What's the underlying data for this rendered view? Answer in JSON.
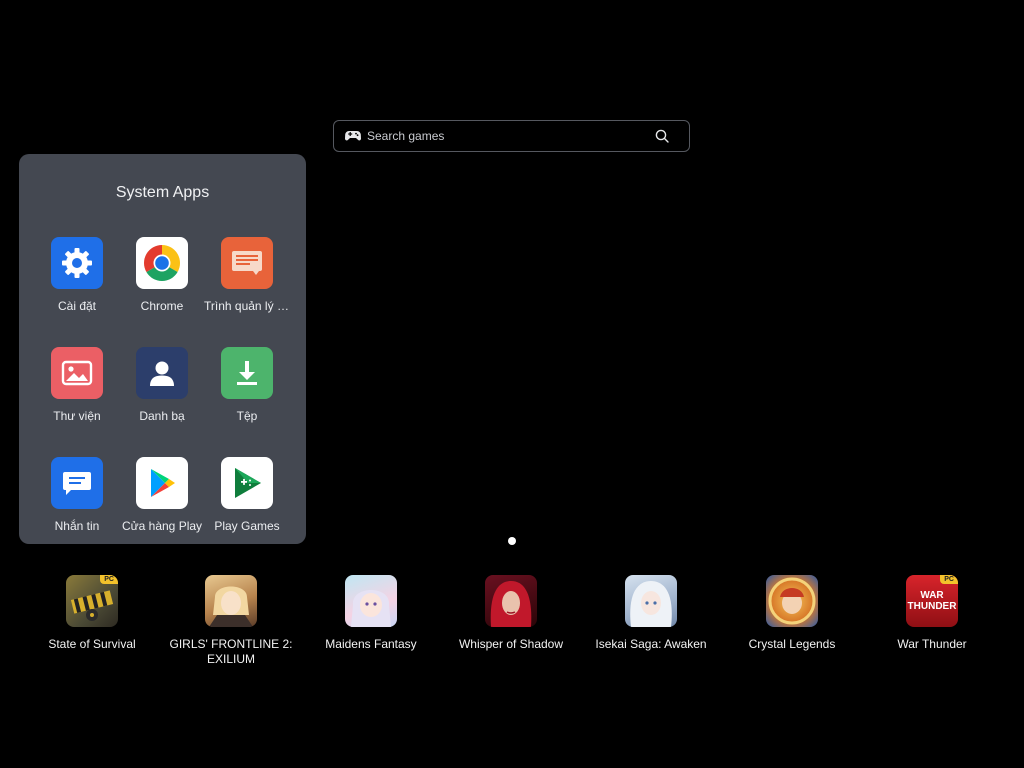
{
  "search": {
    "placeholder": "Search games"
  },
  "system_apps": {
    "title": "System Apps",
    "apps": [
      {
        "label": "Cài đặt",
        "icon": "settings-gear-icon",
        "color": "#1f6fe8"
      },
      {
        "label": "Chrome",
        "icon": "chrome-icon",
        "color": "#ffffff"
      },
      {
        "label": "Trình quản lý tậ...",
        "icon": "file-manager-icon",
        "color": "#e8633a"
      },
      {
        "label": "Thư viện",
        "icon": "gallery-icon",
        "color": "#eb5f65"
      },
      {
        "label": "Danh bạ",
        "icon": "contacts-icon",
        "color": "#2c3e6b"
      },
      {
        "label": "Tệp",
        "icon": "download-icon",
        "color": "#4db46c"
      },
      {
        "label": "Nhắn tin",
        "icon": "messages-icon",
        "color": "#1f6fe8"
      },
      {
        "label": "Cửa hàng Play",
        "icon": "play-store-icon",
        "color": "#ffffff"
      },
      {
        "label": "Play Games",
        "icon": "play-games-icon",
        "color": "#ffffff"
      }
    ]
  },
  "page_indicator": {
    "pages": 1,
    "current": 1
  },
  "games": [
    {
      "label": "State of Survival",
      "badge": "PC"
    },
    {
      "label": "GIRLS' FRONTLINE 2: EXILIUM"
    },
    {
      "label": "Maidens Fantasy"
    },
    {
      "label": "Whisper of Shadow"
    },
    {
      "label": "Isekai Saga: Awaken"
    },
    {
      "label": "Crystal Legends"
    },
    {
      "label": "War Thunder",
      "badge": "PC",
      "icon_text": "WAR THUNDER"
    }
  ]
}
